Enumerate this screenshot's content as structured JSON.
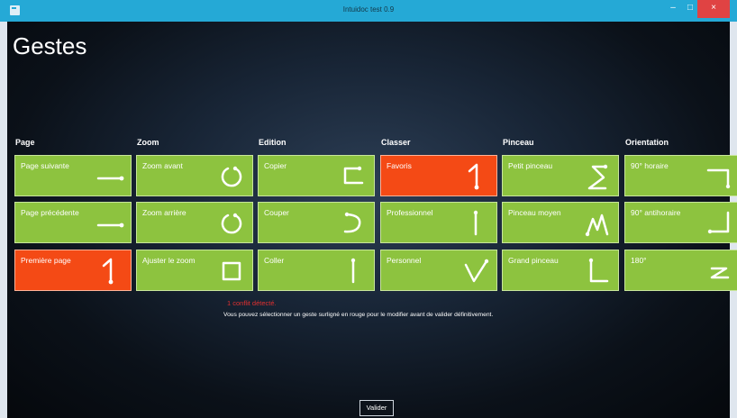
{
  "window": {
    "title": "Intuidoc test 0.9",
    "minimize": "–",
    "maximize": "□",
    "close": "×"
  },
  "page": {
    "title": "Gestes"
  },
  "columns": [
    {
      "header": "Page",
      "tiles": [
        {
          "label": "Page suivante",
          "gesture_icon": "arrow-right-icon",
          "conflict": false
        },
        {
          "label": "Page précédente",
          "gesture_icon": "arrow-right-icon",
          "conflict": false
        },
        {
          "label": "Première page",
          "gesture_icon": "hook-up-icon",
          "conflict": true
        }
      ]
    },
    {
      "header": "Zoom",
      "tiles": [
        {
          "label": "Zoom avant",
          "gesture_icon": "circle-open-top-icon",
          "conflict": false
        },
        {
          "label": "Zoom arrière",
          "gesture_icon": "circle-open-top-icon",
          "conflict": false
        },
        {
          "label": "Ajuster le zoom",
          "gesture_icon": "square-icon",
          "conflict": false
        }
      ]
    },
    {
      "header": "Edition",
      "tiles": [
        {
          "label": "Copier",
          "gesture_icon": "c-bracket-icon",
          "conflict": false
        },
        {
          "label": "Couper",
          "gesture_icon": "reverse-c-icon",
          "conflict": false
        },
        {
          "label": "Coller",
          "gesture_icon": "vertical-line-icon",
          "conflict": false
        }
      ]
    },
    {
      "header": "Classer",
      "tiles": [
        {
          "label": "Favoris",
          "gesture_icon": "hook-up-icon",
          "conflict": true
        },
        {
          "label": "Professionnel",
          "gesture_icon": "vertical-line-icon",
          "conflict": false
        },
        {
          "label": "Personnel",
          "gesture_icon": "check-v-icon",
          "conflict": false
        }
      ]
    },
    {
      "header": "Pinceau",
      "tiles": [
        {
          "label": "Petit pinceau",
          "gesture_icon": "s-shape-icon",
          "conflict": false
        },
        {
          "label": "Pinceau moyen",
          "gesture_icon": "m-shape-icon",
          "conflict": false
        },
        {
          "label": "Grand pinceau",
          "gesture_icon": "l-shape-icon",
          "conflict": false
        }
      ]
    },
    {
      "header": "Orientation",
      "tiles": [
        {
          "label": "90° horaire",
          "gesture_icon": "corner-down-right-icon",
          "conflict": false
        },
        {
          "label": "90° antihoraire",
          "gesture_icon": "corner-up-left-icon",
          "conflict": false
        },
        {
          "label": "180°",
          "gesture_icon": "z-shape-icon",
          "conflict": false
        }
      ]
    }
  ],
  "messages": {
    "conflict": "1 conflit détecté.",
    "info": "Vous pouvez sélectionner un geste surligné en rouge pour le modifier avant de valider définitivement."
  },
  "validate_button": "Valider"
}
